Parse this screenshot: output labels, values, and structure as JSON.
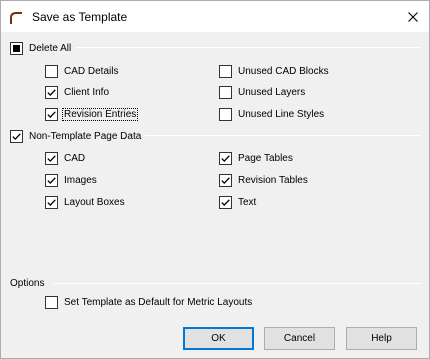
{
  "window": {
    "title": "Save as Template"
  },
  "delete_all": {
    "label": "Delete All",
    "state": "indeterminate",
    "items": [
      {
        "label": "CAD Details",
        "checked": false
      },
      {
        "label": "Unused CAD Blocks",
        "checked": false
      },
      {
        "label": "Client Info",
        "checked": true
      },
      {
        "label": "Unused Layers",
        "checked": false
      },
      {
        "label": "Revision Entries",
        "checked": true
      },
      {
        "label": "Unused Line Styles",
        "checked": false
      }
    ]
  },
  "non_template": {
    "label": "Non-Template Page Data",
    "checked": true,
    "items": [
      {
        "label": "CAD",
        "checked": true
      },
      {
        "label": "Page Tables",
        "checked": true
      },
      {
        "label": "Images",
        "checked": true
      },
      {
        "label": "Revision Tables",
        "checked": true
      },
      {
        "label": "Layout Boxes",
        "checked": true
      },
      {
        "label": "Text",
        "checked": true
      }
    ]
  },
  "options": {
    "label": "Options",
    "metric_default": {
      "label": "Set Template as Default for Metric Layouts",
      "checked": false
    }
  },
  "buttons": {
    "ok": "OK",
    "cancel": "Cancel",
    "help": "Help"
  }
}
